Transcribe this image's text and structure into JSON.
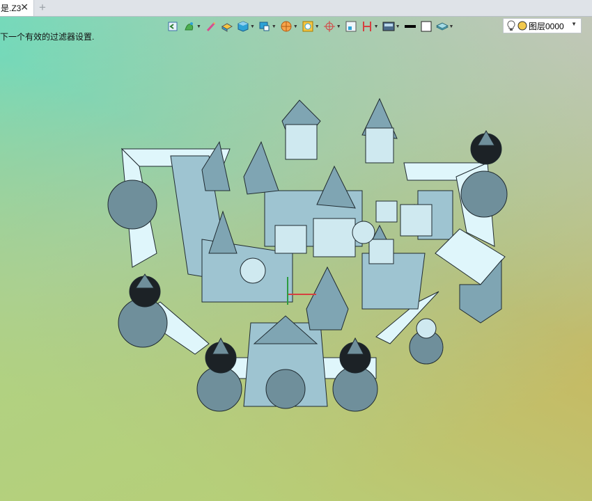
{
  "tab": {
    "title": "是.Z3",
    "close": "✕",
    "add": "+"
  },
  "status_text": "下一个有效的过滤器设置.",
  "layer": {
    "label": "图层0000"
  },
  "toolbar_icons": [
    "view-icon",
    "paint-icon",
    "brush-icon",
    "shade-icon",
    "cube-icon",
    "display-icon",
    "render-icon",
    "frame-icon",
    "axis-icon",
    "grid-icon",
    "clip-icon",
    "background-icon",
    "line-color-icon",
    "rect-icon",
    "plane-icon"
  ],
  "colors": {
    "accent": "#2ea3d6",
    "bulb": "#f2c94c",
    "model_fill": "#9ec4d1",
    "model_light": "#dff6fb"
  }
}
